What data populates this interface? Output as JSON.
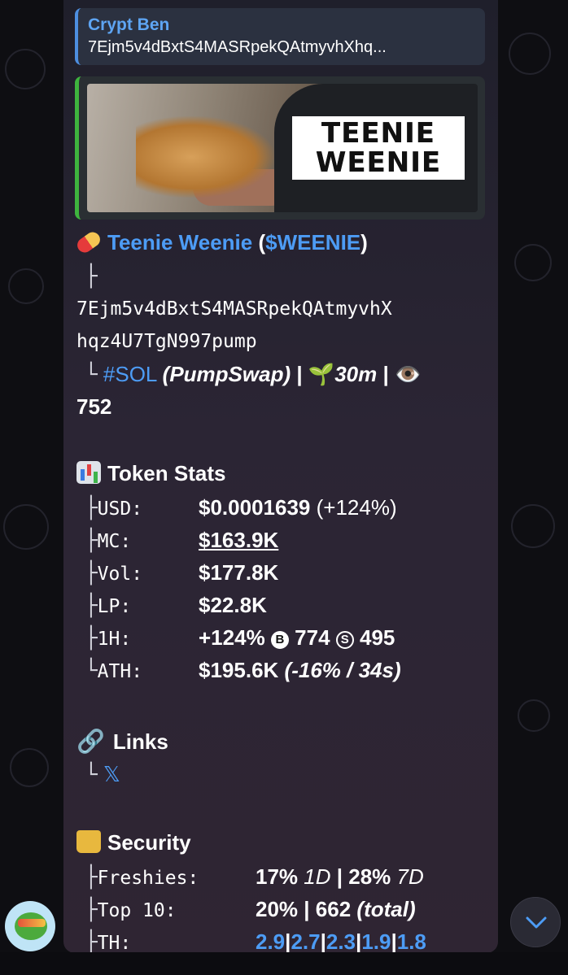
{
  "reply": {
    "name": "Crypt Ben",
    "text": "7Ejm5v4dBxtS4MASRpekQAtmyvhXhq..."
  },
  "preview": {
    "image_text_line1": "TEENIE",
    "image_text_line2": "WEENIE"
  },
  "token": {
    "name": "Teenie Weenie",
    "open_paren": " (",
    "ticker": "$WEENIE",
    "close_paren": ")",
    "branch_top": "├",
    "address_line1": "7Ejm5v4dBxtS4MASRpekQAtmyvhX",
    "address_line2": "hqz4U7TgN997pump",
    "branch_end": "└",
    "chain": "#SOL",
    "dex": "(PumpSwap)",
    "sep1": " | ",
    "age_icon": "🌱",
    "age": "30m",
    "sep2": " | ",
    "views_icon": "👁️",
    "views": "752"
  },
  "token_stats": {
    "title": "Token Stats",
    "rows": [
      {
        "branch": "├",
        "label": "USD:",
        "value": "$0.0001639",
        "extra": " (+124%)"
      },
      {
        "branch": "├",
        "label": "MC:",
        "value": "$163.9K",
        "extra": ""
      },
      {
        "branch": "├",
        "label": "Vol:",
        "value": "$177.8K",
        "extra": ""
      },
      {
        "branch": "├",
        "label": "LP:",
        "value": "$22.8K",
        "extra": ""
      },
      {
        "branch": "├",
        "label": "1H:",
        "value": "+124%",
        "buy_icon": "B",
        "buys": "774",
        "sell_icon": "S",
        "sells": "495"
      },
      {
        "branch": "└",
        "label": "ATH:",
        "value": "$195.6K",
        "extra": "(-16% / 34s)"
      }
    ]
  },
  "links": {
    "title": "Links",
    "branch": "└",
    "x_link": "𝕏"
  },
  "security": {
    "title": "Security",
    "rows": [
      {
        "branch": "├",
        "label": "Freshies:",
        "v1": "17%",
        "v1b": "1D",
        "sep": " | ",
        "v2": "28%",
        "v2b": "7D"
      },
      {
        "branch": "├",
        "label": "Top 10:",
        "v1": "20%",
        "sep": " | ",
        "v2": "662",
        "v2b": "(total)"
      },
      {
        "branch": "├",
        "label": "TH:",
        "holders": [
          "2.9",
          "2.7",
          "2.3",
          "1.9",
          "1.8"
        ],
        "sep": "|"
      }
    ]
  },
  "colors": {
    "accent_blue": "#4d9cf5",
    "reply_bar": "#4d8ee0",
    "preview_bar": "#3eb43e"
  },
  "icons": {
    "pill": "pill-icon",
    "chart": "bar-chart-icon",
    "link": "link-icon",
    "lock": "lock-icon",
    "scroll": "chevron-down-icon"
  }
}
